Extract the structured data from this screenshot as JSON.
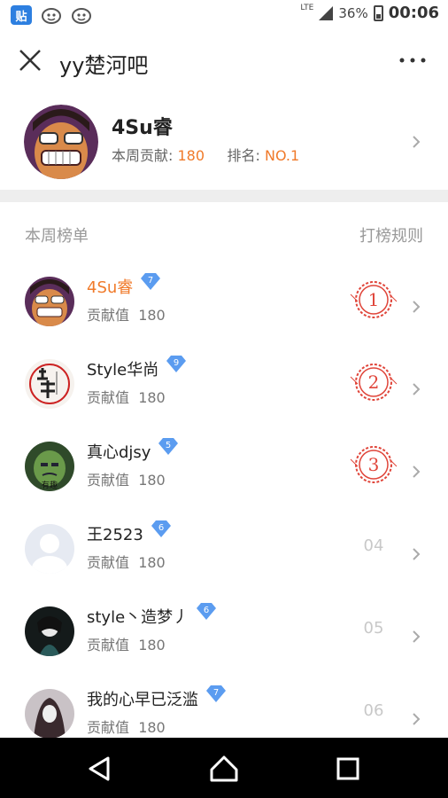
{
  "status_bar": {
    "app_icon_label": "贴",
    "network": "LTE",
    "battery": "36%",
    "time": "00:06"
  },
  "header": {
    "title": "yy楚河吧"
  },
  "profile": {
    "name": "4Su睿",
    "week_contribution_label": "本周贡献:",
    "week_contribution_value": "180",
    "rank_label": "排名:",
    "rank_value": "NO.1"
  },
  "list": {
    "title": "本周榜单",
    "rules_link": "打榜规则",
    "contribution_label": "贡献值",
    "rows": [
      {
        "name": "4Su睿",
        "level": "7",
        "value": "180",
        "rank": "1"
      },
      {
        "name": "Style华尚",
        "level": "9",
        "value": "180",
        "rank": "2"
      },
      {
        "name": "真心djsy",
        "level": "5",
        "value": "180",
        "rank": "3"
      },
      {
        "name": "王2523",
        "level": "6",
        "value": "180",
        "rank": "04"
      },
      {
        "name": "style丶造梦丿",
        "level": "6",
        "value": "180",
        "rank": "05"
      },
      {
        "name": "我的心早已泛滥",
        "level": "7",
        "value": "180",
        "rank": "06"
      }
    ]
  },
  "colors": {
    "accent": "#f07a2a",
    "seal": "#e0453a",
    "badge": "#5b9cf0"
  }
}
